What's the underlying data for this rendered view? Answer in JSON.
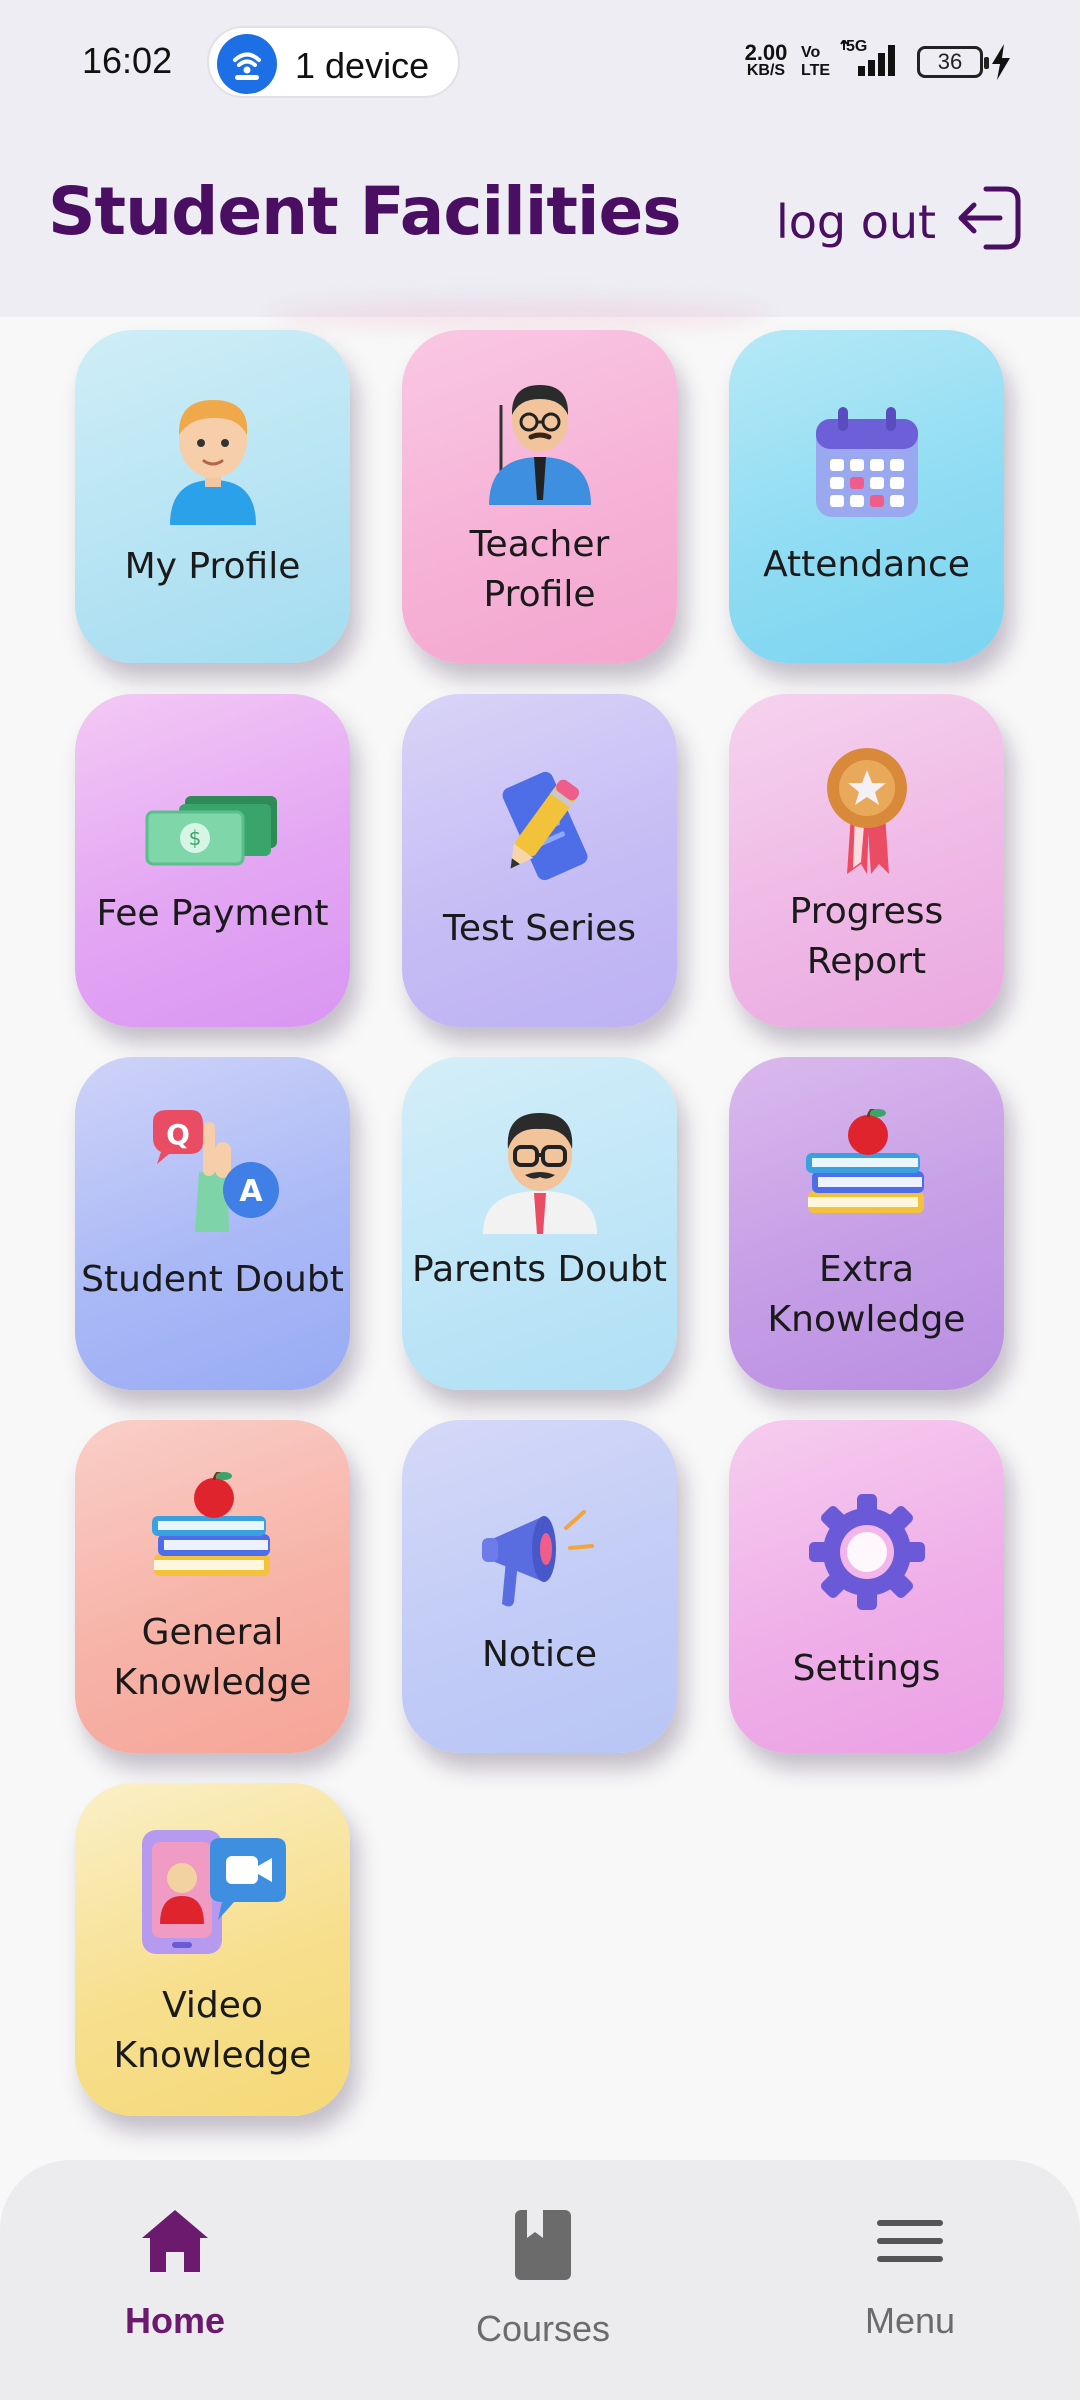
{
  "status_bar": {
    "time": "16:02",
    "hotspot_label": "1 device",
    "net_speed": "2.00",
    "net_speed_unit": "KB/S",
    "volte_top": "Vo",
    "volte_bottom": "LTE",
    "network": "5G",
    "battery": "36"
  },
  "header": {
    "title": "Student Facilities",
    "logout_label": "log out",
    "title_color": "#4a0e62"
  },
  "tiles": [
    {
      "label": "My Profile",
      "icon": "student-avatar-icon"
    },
    {
      "label": "Teacher Profile",
      "icon": "teacher-avatar-icon"
    },
    {
      "label": "Attendance",
      "icon": "calendar-icon"
    },
    {
      "label": "Fee Payment",
      "icon": "money-icon"
    },
    {
      "label": "Test Series",
      "icon": "pencil-paper-icon"
    },
    {
      "label": "Progress Report",
      "icon": "medal-icon"
    },
    {
      "label": "Student Doubt",
      "icon": "question-answer-icon"
    },
    {
      "label": "Parents Doubt",
      "icon": "parent-avatar-icon"
    },
    {
      "label": "Extra Knowledge",
      "icon": "books-apple-icon"
    },
    {
      "label": "General Knowledge",
      "icon": "books-apple-icon"
    },
    {
      "label": "Notice",
      "icon": "megaphone-icon"
    },
    {
      "label": "Settings",
      "icon": "gear-icon"
    },
    {
      "label": "Video Knowledge",
      "icon": "video-call-icon"
    }
  ],
  "bottom_nav": {
    "items": [
      {
        "label": "Home",
        "icon": "home-icon",
        "active": true
      },
      {
        "label": "Courses",
        "icon": "book-icon",
        "active": false
      },
      {
        "label": "Menu",
        "icon": "menu-icon",
        "active": false
      }
    ],
    "active_color": "#6b1a6e",
    "inactive_color": "#6b6b6b"
  }
}
